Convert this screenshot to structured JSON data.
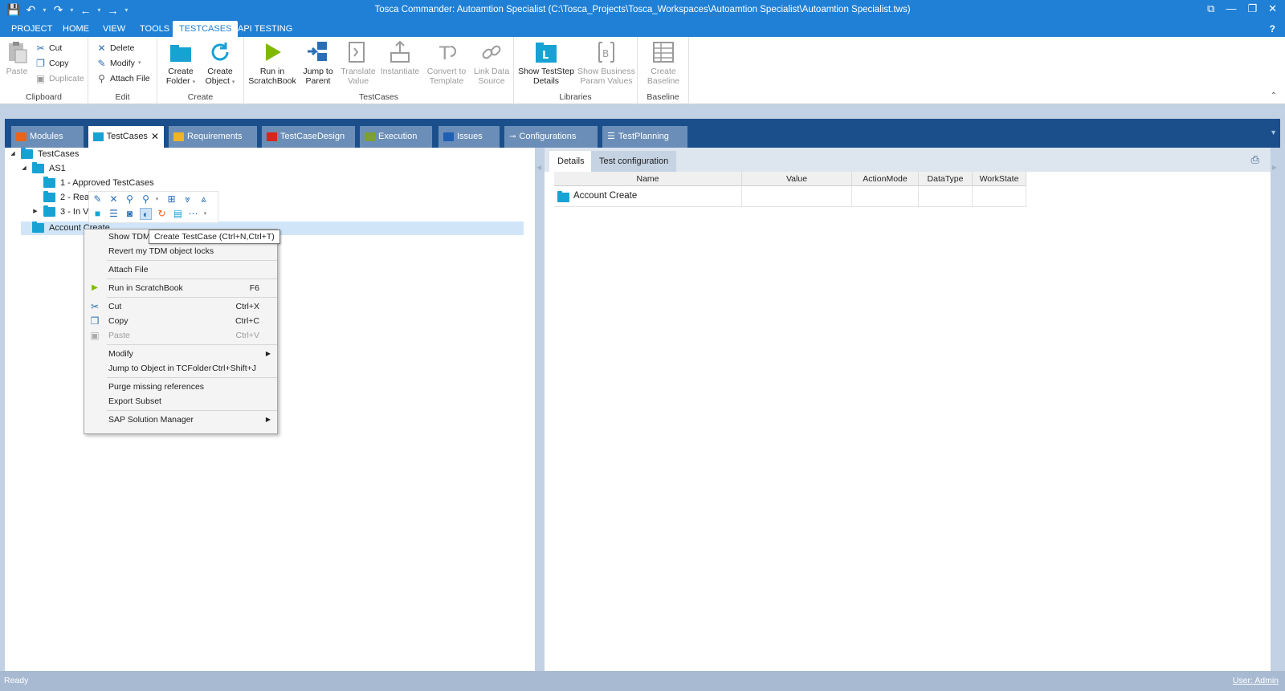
{
  "window": {
    "title": "Tosca Commander: Autoamtion Specialist (C:\\Tosca_Projects\\Tosca_Workspaces\\Autoamtion Specialist\\Autoamtion Specialist.tws)"
  },
  "ribbon_tabs": [
    {
      "label": "PROJECT"
    },
    {
      "label": "HOME"
    },
    {
      "label": "VIEW"
    },
    {
      "label": "TOOLS"
    },
    {
      "label": "TESTCASES"
    },
    {
      "label": "API TESTING"
    }
  ],
  "help_label": "?",
  "ribbon": {
    "clipboard": {
      "label": "Clipboard",
      "paste": "Paste",
      "cut": "Cut",
      "copy": "Copy",
      "duplicate": "Duplicate"
    },
    "edit": {
      "label": "Edit",
      "delete": "Delete",
      "modify": "Modify",
      "attach_file": "Attach File"
    },
    "create": {
      "label": "Create",
      "create_folder_1": "Create",
      "create_folder_2": "Folder",
      "create_object_1": "Create",
      "create_object_2": "Object"
    },
    "testcases": {
      "label": "TestCases",
      "run_1": "Run in",
      "run_2": "ScratchBook",
      "jump_1": "Jump to",
      "jump_2": "Parent",
      "translate_1": "Translate",
      "translate_2": "Value",
      "instantiate_1": "Instantiate",
      "convert_1": "Convert to",
      "convert_2": "Template",
      "link_1": "Link Data",
      "link_2": "Source"
    },
    "libraries": {
      "label": "Libraries",
      "show_step_1": "Show TestStep",
      "show_step_2": "Details",
      "show_biz_1": "Show Business",
      "show_biz_2": "Param Values"
    },
    "baseline": {
      "label": "Baseline",
      "create_1": "Create",
      "create_2": "Baseline"
    }
  },
  "doc_tabs": [
    {
      "label": "Modules",
      "color": "#e8641d"
    },
    {
      "label": "TestCases",
      "color": "#17a2d4",
      "close": "✕"
    },
    {
      "label": "Requirements",
      "color": "#f0b323"
    },
    {
      "label": "TestCaseDesign",
      "color": "#d6261f"
    },
    {
      "label": "Execution",
      "color": "#7da02e"
    },
    {
      "label": "Issues",
      "color": "#1f5fb3"
    },
    {
      "label": "Configurations",
      "color": "#ffffff"
    },
    {
      "label": "TestPlanning",
      "color": "#ffffff"
    }
  ],
  "tree": [
    {
      "label": "TestCases"
    },
    {
      "label": "AS1"
    },
    {
      "label": "1 - Approved TestCases"
    },
    {
      "label": "2 - Rea"
    },
    {
      "label": "3 - In V"
    },
    {
      "label": "Account Create"
    }
  ],
  "tooltip": "Create TestCase (Ctrl+N,Ctrl+T)",
  "context_menu": [
    {
      "label": "Show TDM",
      "shortcut": ""
    },
    {
      "label": "Revert my TDM object locks",
      "shortcut": ""
    },
    {
      "label": "Attach File",
      "shortcut": ""
    },
    {
      "label": "Run in ScratchBook",
      "shortcut": "F6"
    },
    {
      "label": "Cut",
      "shortcut": "Ctrl+X"
    },
    {
      "label": "Copy",
      "shortcut": "Ctrl+C"
    },
    {
      "label": "Paste",
      "shortcut": "Ctrl+V"
    },
    {
      "label": "Modify",
      "shortcut": ""
    },
    {
      "label": "Jump to Object in TCFolder",
      "shortcut": "Ctrl+Shift+J"
    },
    {
      "label": "Purge missing references",
      "shortcut": ""
    },
    {
      "label": "Export Subset",
      "shortcut": ""
    },
    {
      "label": "SAP Solution Manager",
      "shortcut": ""
    }
  ],
  "details": {
    "tabs": [
      {
        "label": "Details"
      },
      {
        "label": "Test configuration"
      }
    ],
    "columns": [
      "Name",
      "Value",
      "ActionMode",
      "DataType",
      "WorkState"
    ],
    "rows": [
      {
        "name": "Account Create"
      }
    ]
  },
  "status": {
    "text": "Ready",
    "user": "User: Admin"
  }
}
